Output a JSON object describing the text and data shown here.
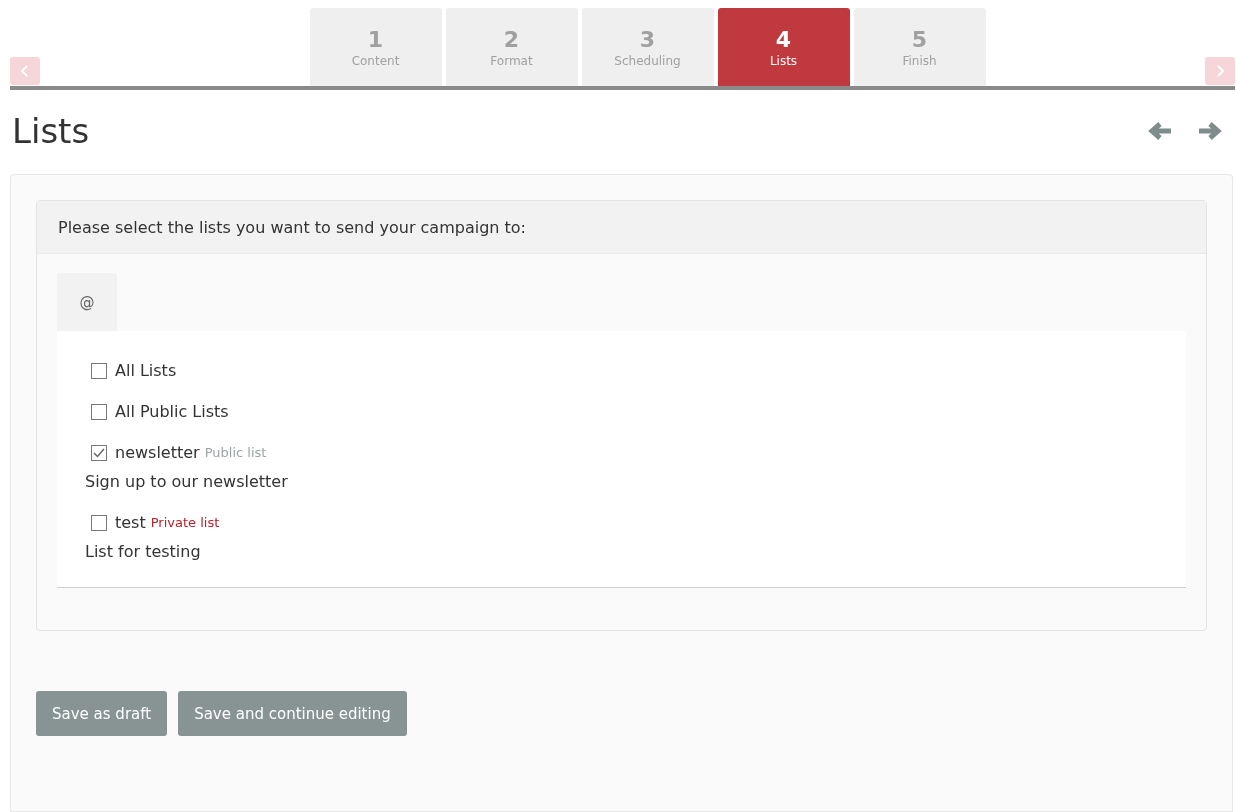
{
  "steps": [
    {
      "number": "1",
      "label": "Content",
      "selected": false
    },
    {
      "number": "2",
      "label": "Format",
      "selected": false
    },
    {
      "number": "3",
      "label": "Scheduling",
      "selected": false
    },
    {
      "number": "4",
      "label": "Lists",
      "selected": true
    },
    {
      "number": "5",
      "label": "Finish",
      "selected": false
    }
  ],
  "title": "Lists",
  "panel": {
    "heading": "Please select the lists you want to send your campaign to:",
    "tabs": [
      {
        "label": "@"
      }
    ],
    "items": [
      {
        "kind": "option",
        "label": "All Lists",
        "checked": false
      },
      {
        "kind": "option",
        "label": "All Public Lists",
        "checked": false
      },
      {
        "kind": "list",
        "label": "newsletter",
        "checked": true,
        "tag": "Public list",
        "color": "#9aa5a5",
        "description": "Sign up to our newsletter"
      },
      {
        "kind": "list",
        "label": "test",
        "checked": false,
        "tag": "Private list",
        "color": "#b8202a",
        "description": "List for testing"
      }
    ]
  },
  "buttons": [
    "Save as draft",
    "Save and continue editing"
  ]
}
